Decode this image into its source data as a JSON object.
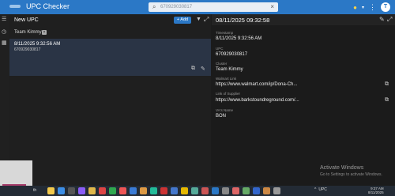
{
  "app": {
    "title": "UPC Checker"
  },
  "search": {
    "placeholder": "670929030817"
  },
  "user": {
    "initial": "T"
  },
  "left_panel": {
    "title": "New UPC",
    "add_label": "+ Add",
    "filter_chip": "Team Kimmy",
    "records": [
      {
        "timestamp": "8/11/2025 9:32:56 AM",
        "upc": "670929030817"
      }
    ]
  },
  "detail": {
    "title": "08/11/2025 09:32:58",
    "fields": [
      {
        "label": "Timestamp",
        "value": "8/11/2025 9:32:56 AM"
      },
      {
        "label": "UPC",
        "value": "670929030817"
      },
      {
        "label": "Cluster",
        "value": "Team Kimmy"
      },
      {
        "label": "Walmart Link",
        "value": "https://www.walmart.com/ip/Dona-Ch..."
      },
      {
        "label": "Link of Supplier",
        "value": "https://www.barkstoundreground.com/..."
      },
      {
        "label": "VA's Name",
        "value": "BON"
      }
    ]
  },
  "watermark": {
    "line1": "Activate Windows",
    "line2": "Go to Settings to activate Windows."
  },
  "taskbar": {
    "thumb_caption": "th",
    "tray_text": "UPC",
    "time": "9:37 AM",
    "date": "8/11/2025"
  },
  "colors": {
    "accent": "#2b78c6",
    "selected_row": "#2a3445"
  }
}
